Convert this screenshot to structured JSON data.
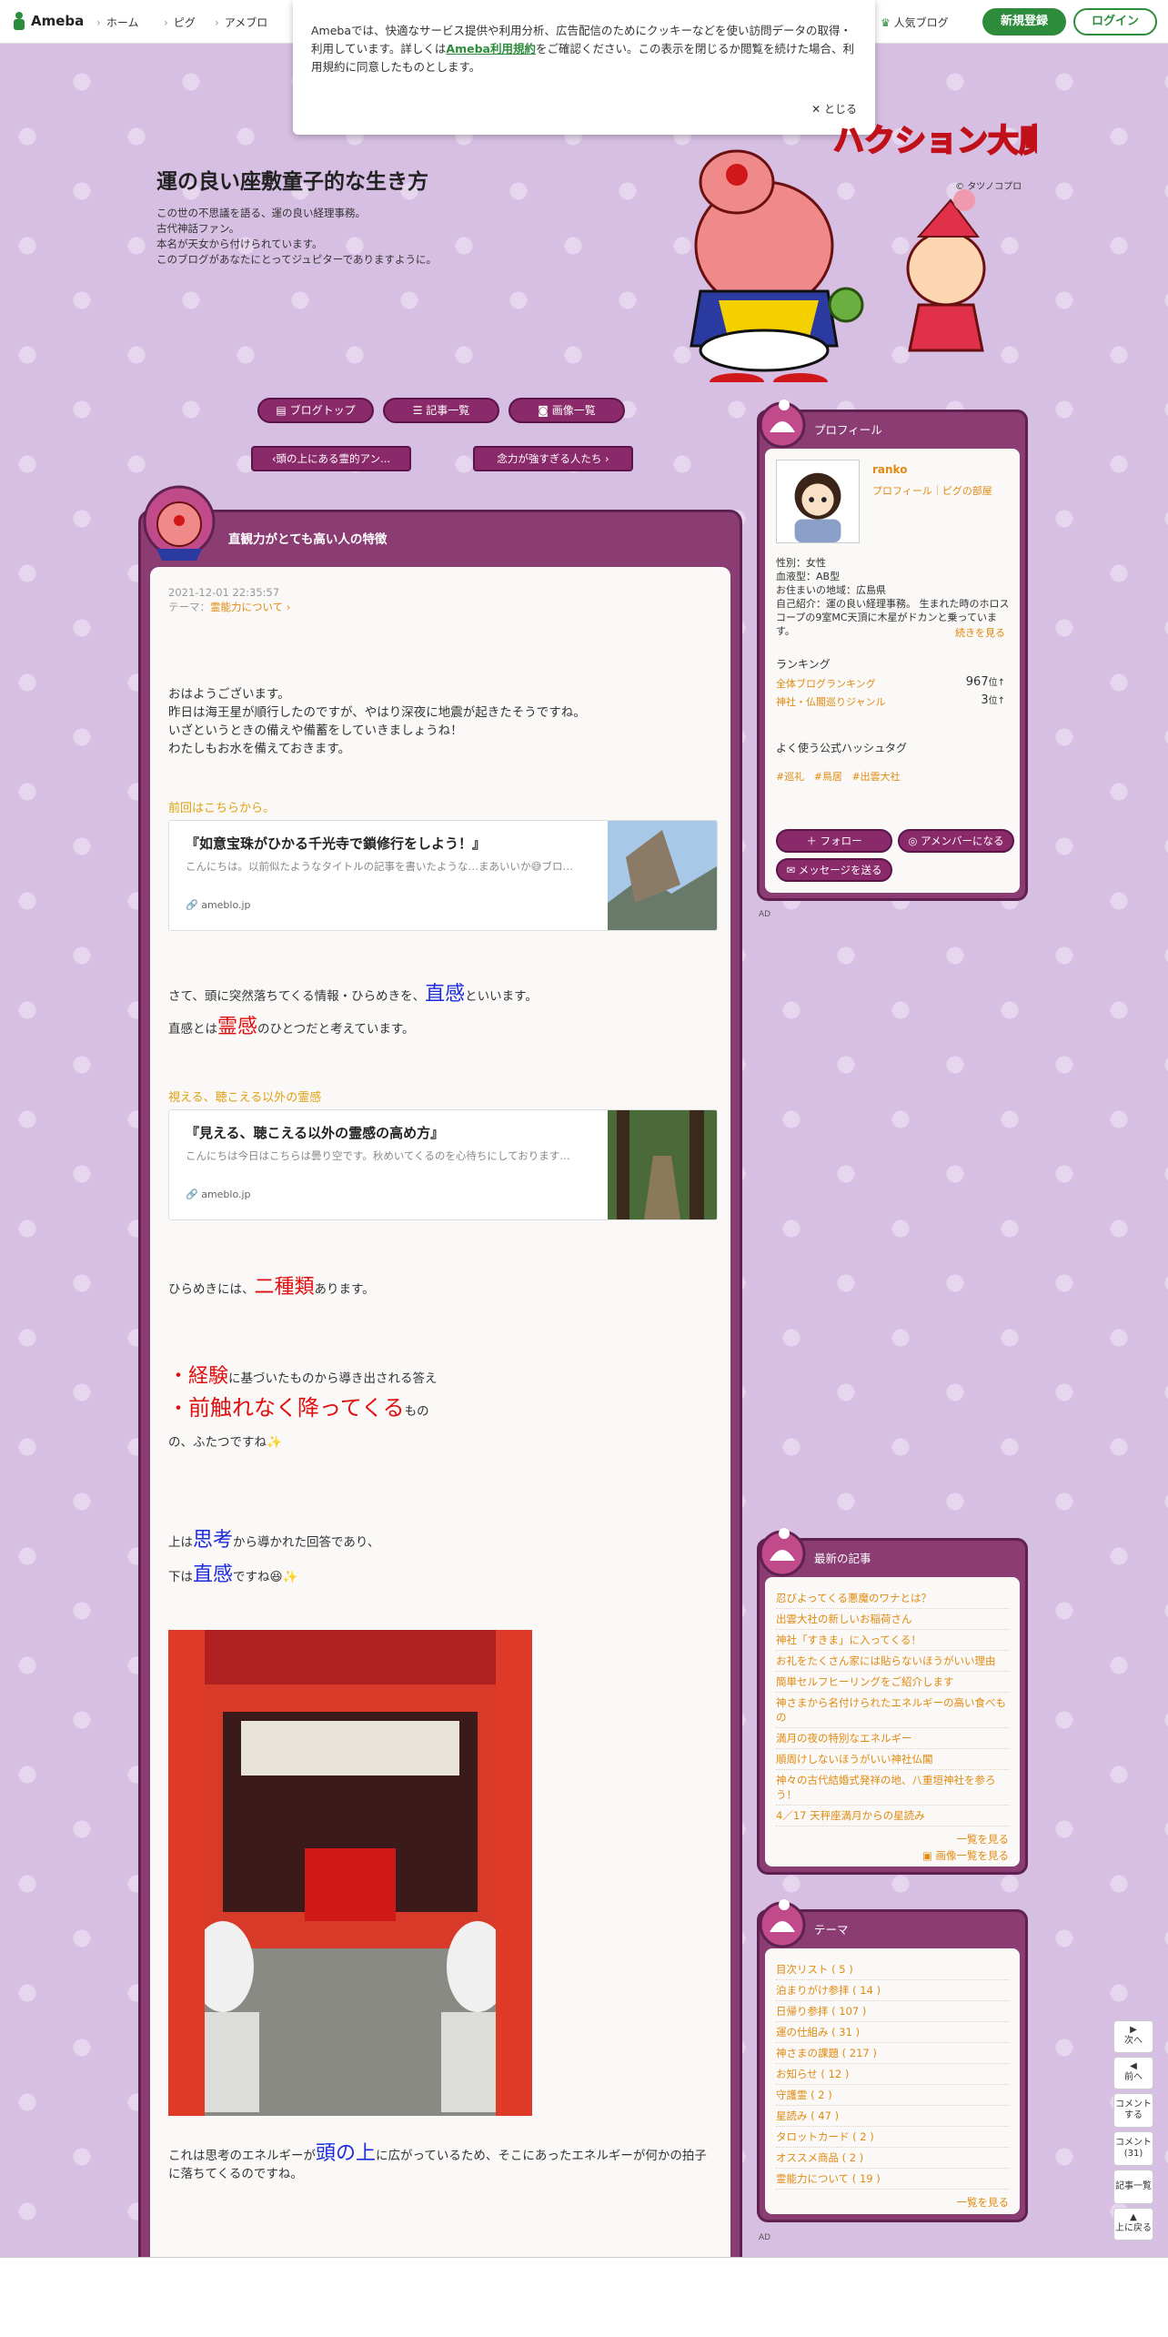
{
  "topbar": {
    "logo": "Ameba",
    "nav": [
      "ホーム",
      "ピグ",
      "アメブロ"
    ],
    "popular": "人気ブログ",
    "signup": "新規登録",
    "login": "ログイン"
  },
  "cookie": {
    "text1": "Amebaでは、快適なサービス提供や利用分析、広告配信のためにクッキーなどを使い訪問データの取得・利用しています。詳しくは",
    "link": "Ameba利用規約",
    "text2": "をご確認ください。この表示を閉じるか閲覧を続けた場合、利用規約に同意したものとします。",
    "close": "とじる"
  },
  "blog": {
    "title": "運の良い座敷童子的な生き方",
    "desc": "この世の不思議を語る、運の良い経理事務。\n古代神話ファン。\n本名が天女から付けられています。\nこのブログがあなたにとってジュピターでありますように。",
    "copyright": "タツノコプロ"
  },
  "buttons": {
    "top": "ブログトップ",
    "list": "記事一覧",
    "images": "画像一覧",
    "prev": "頭の上にある霊的アン...",
    "next": "念力が強すぎる人たち"
  },
  "article": {
    "title": "直観力がとても高い人の特徴",
    "date": "2021-12-01 22:35:57",
    "theme_label": "テーマ：",
    "theme": "霊能力について",
    "intro": [
      "おはようございます。",
      "昨日は海王星が順行したのですが、やはり深夜に地震が起きたそうですね。",
      "いざというときの備えや備蓄をしていきましょうね！",
      "わたしもお水を備えておきます。"
    ],
    "sub1": "前回はこちらから。",
    "card1": {
      "title": "『如意宝珠がひかる千光寺で鎖修行をしよう！』",
      "desc": "こんにちは。以前似たようなタイトルの記事を書いたような…まあいいか😅ブロ…",
      "url": "ameblo.jp"
    },
    "line1a": "さて、頭に突然落ちてくる情報・ひらめきを、",
    "kw1": "直感",
    "line1b": "といいます。",
    "line2a": "直感とは",
    "kw2": "霊感",
    "line2b": "のひとつだと考えています。",
    "sub2": "視える、聴こえる以外の霊感",
    "card2": {
      "title": "『見える、聴こえる以外の霊感の高め方』",
      "desc": "こんにちは今日はこちらは曇り空です。秋めいてくるのを心待ちにしております…",
      "url": "ameblo.jp"
    },
    "line3a": "ひらめきには、",
    "kw3": "二種類",
    "line3b": "あります。",
    "bul1a": "・",
    "kw4": "経験",
    "bul1b": "に基づいたものから導き出される答え",
    "bul2a": "・",
    "kw5": "前触れなく降ってくる",
    "bul2b": "もの",
    "bul3": "の、ふたつですね✨",
    "line4a": "上は",
    "kw6": "思考",
    "line4b": "から導かれた回答であり、",
    "line5a": "下は",
    "kw7": "直感",
    "line5b": "ですね😆✨",
    "line6a": "これは思考のエネルギーが",
    "kw8": "頭の上",
    "line6b": "に広がっているため、そこにあったエネルギーが何かの拍子に落ちてくるのですね。"
  },
  "profile": {
    "header": "プロフィール",
    "name": "ranko",
    "links": "プロフィール｜ピグの部屋",
    "gender": "性別：女性",
    "blood": "血液型：AB型",
    "area": "お住まいの地域：広島県",
    "intro": "自己紹介：運の良い経理事務。 生まれた時のホロスコープの9室MC天頂に木星がドカンと乗っています。",
    "more": "続きを見る",
    "ranking_title": "ランキング",
    "rank1_label": "全体ブログランキング",
    "rank1_value": "967",
    "rank2_label": "神社・仏閣巡りジャンル",
    "rank2_value": "3",
    "rank_unit": "位",
    "hashtag_title": "よく使う公式ハッシュタグ",
    "hashtags": [
      "#巡礼",
      "#鳥居",
      "#出雲大社"
    ],
    "follow": "フォロー",
    "member": "アメンバーになる",
    "message": "メッセージを送る"
  },
  "recent": {
    "header": "最新の記事",
    "items": [
      "忍びよってくる悪魔のワナとは？",
      "出雲大社の新しいお稲荷さん",
      "神社「すきま」に入ってくる！",
      "お礼をたくさん家には貼らないほうがいい理由",
      "簡単セルフヒーリングをご紹介します",
      "神さまから名付けられたエネルギーの高い食べもの",
      "満月の夜の特別なエネルギー",
      "順周けしないほうがいい神社仏閣",
      "神々の古代結婚式発祥の地、八重垣神社を参ろう！",
      "4／17 天秤座満月からの星読み"
    ],
    "more": "一覧を見る",
    "images": "画像一覧を見る"
  },
  "themes": {
    "header": "テーマ",
    "items": [
      "目次リスト ( 5 )",
      "泊まりがけ参拝 ( 14 )",
      "日帰り参拝 ( 107 )",
      "運の仕組み ( 31 )",
      "神さまの課題 ( 217 )",
      "お知らせ ( 12 )",
      "守護霊 ( 2 )",
      "星読み ( 47 )",
      "タロットカード ( 2 )",
      "オススメ商品 ( 2 )",
      "霊能力について ( 19 )"
    ],
    "more": "一覧を見る"
  },
  "ad": "AD",
  "fab": {
    "next": "次へ",
    "prev": "前へ",
    "comment": "コメント する",
    "comments": "コメント (31)",
    "list": "記事一覧",
    "top": "上に戻る"
  }
}
